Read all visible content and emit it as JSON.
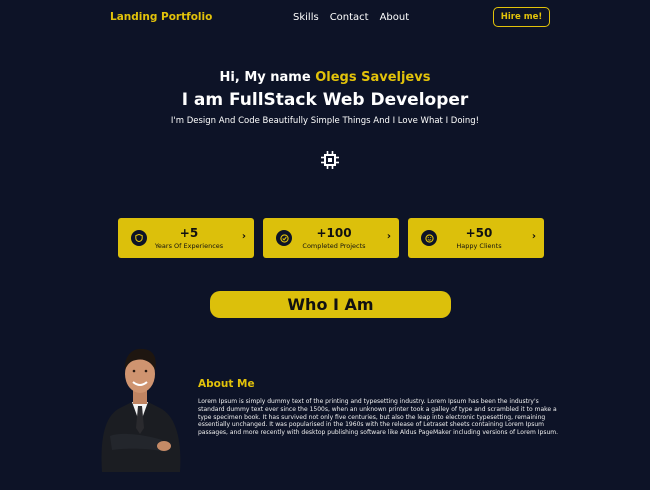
{
  "nav": {
    "brand": "Landing Portfolio",
    "links": [
      "Skills",
      "Contact",
      "About"
    ],
    "hire_label": "Hire me!"
  },
  "hero": {
    "greeting": "Hi, My name",
    "name": "Olegs Saveljevs",
    "role": "I am FullStack Web Developer",
    "tagline": "I'm Design And Code Beautifully Simple Things And I Love What I Doing!",
    "icon": "chip-icon"
  },
  "stats": [
    {
      "value": "+5",
      "label": "Years Of Experiences",
      "icon": "shield-icon"
    },
    {
      "value": "+100",
      "label": "Completed Projects",
      "icon": "check-circle-icon"
    },
    {
      "value": "+50",
      "label": "Happy Clients",
      "icon": "smile-icon"
    }
  ],
  "who": {
    "heading": "Who I Am"
  },
  "about": {
    "title": "About Me",
    "text": "Lorem Ipsum is simply dummy text of the printing and typesetting industry. Lorem Ipsum has been the industry's standard dummy text ever since the 1500s, when an unknown printer took a galley of type and scrambled it to make a type specimen book. It has survived not only five centuries, but also the leap into electronic typesetting, remaining essentially unchanged. It was popularised in the 1960s with the release of Letraset sheets containing Lorem Ipsum passages, and more recently with desktop publishing software like Aldus PageMaker including versions of Lorem Ipsum."
  },
  "colors": {
    "background": "#0d1327",
    "accent": "#e2c20a"
  }
}
